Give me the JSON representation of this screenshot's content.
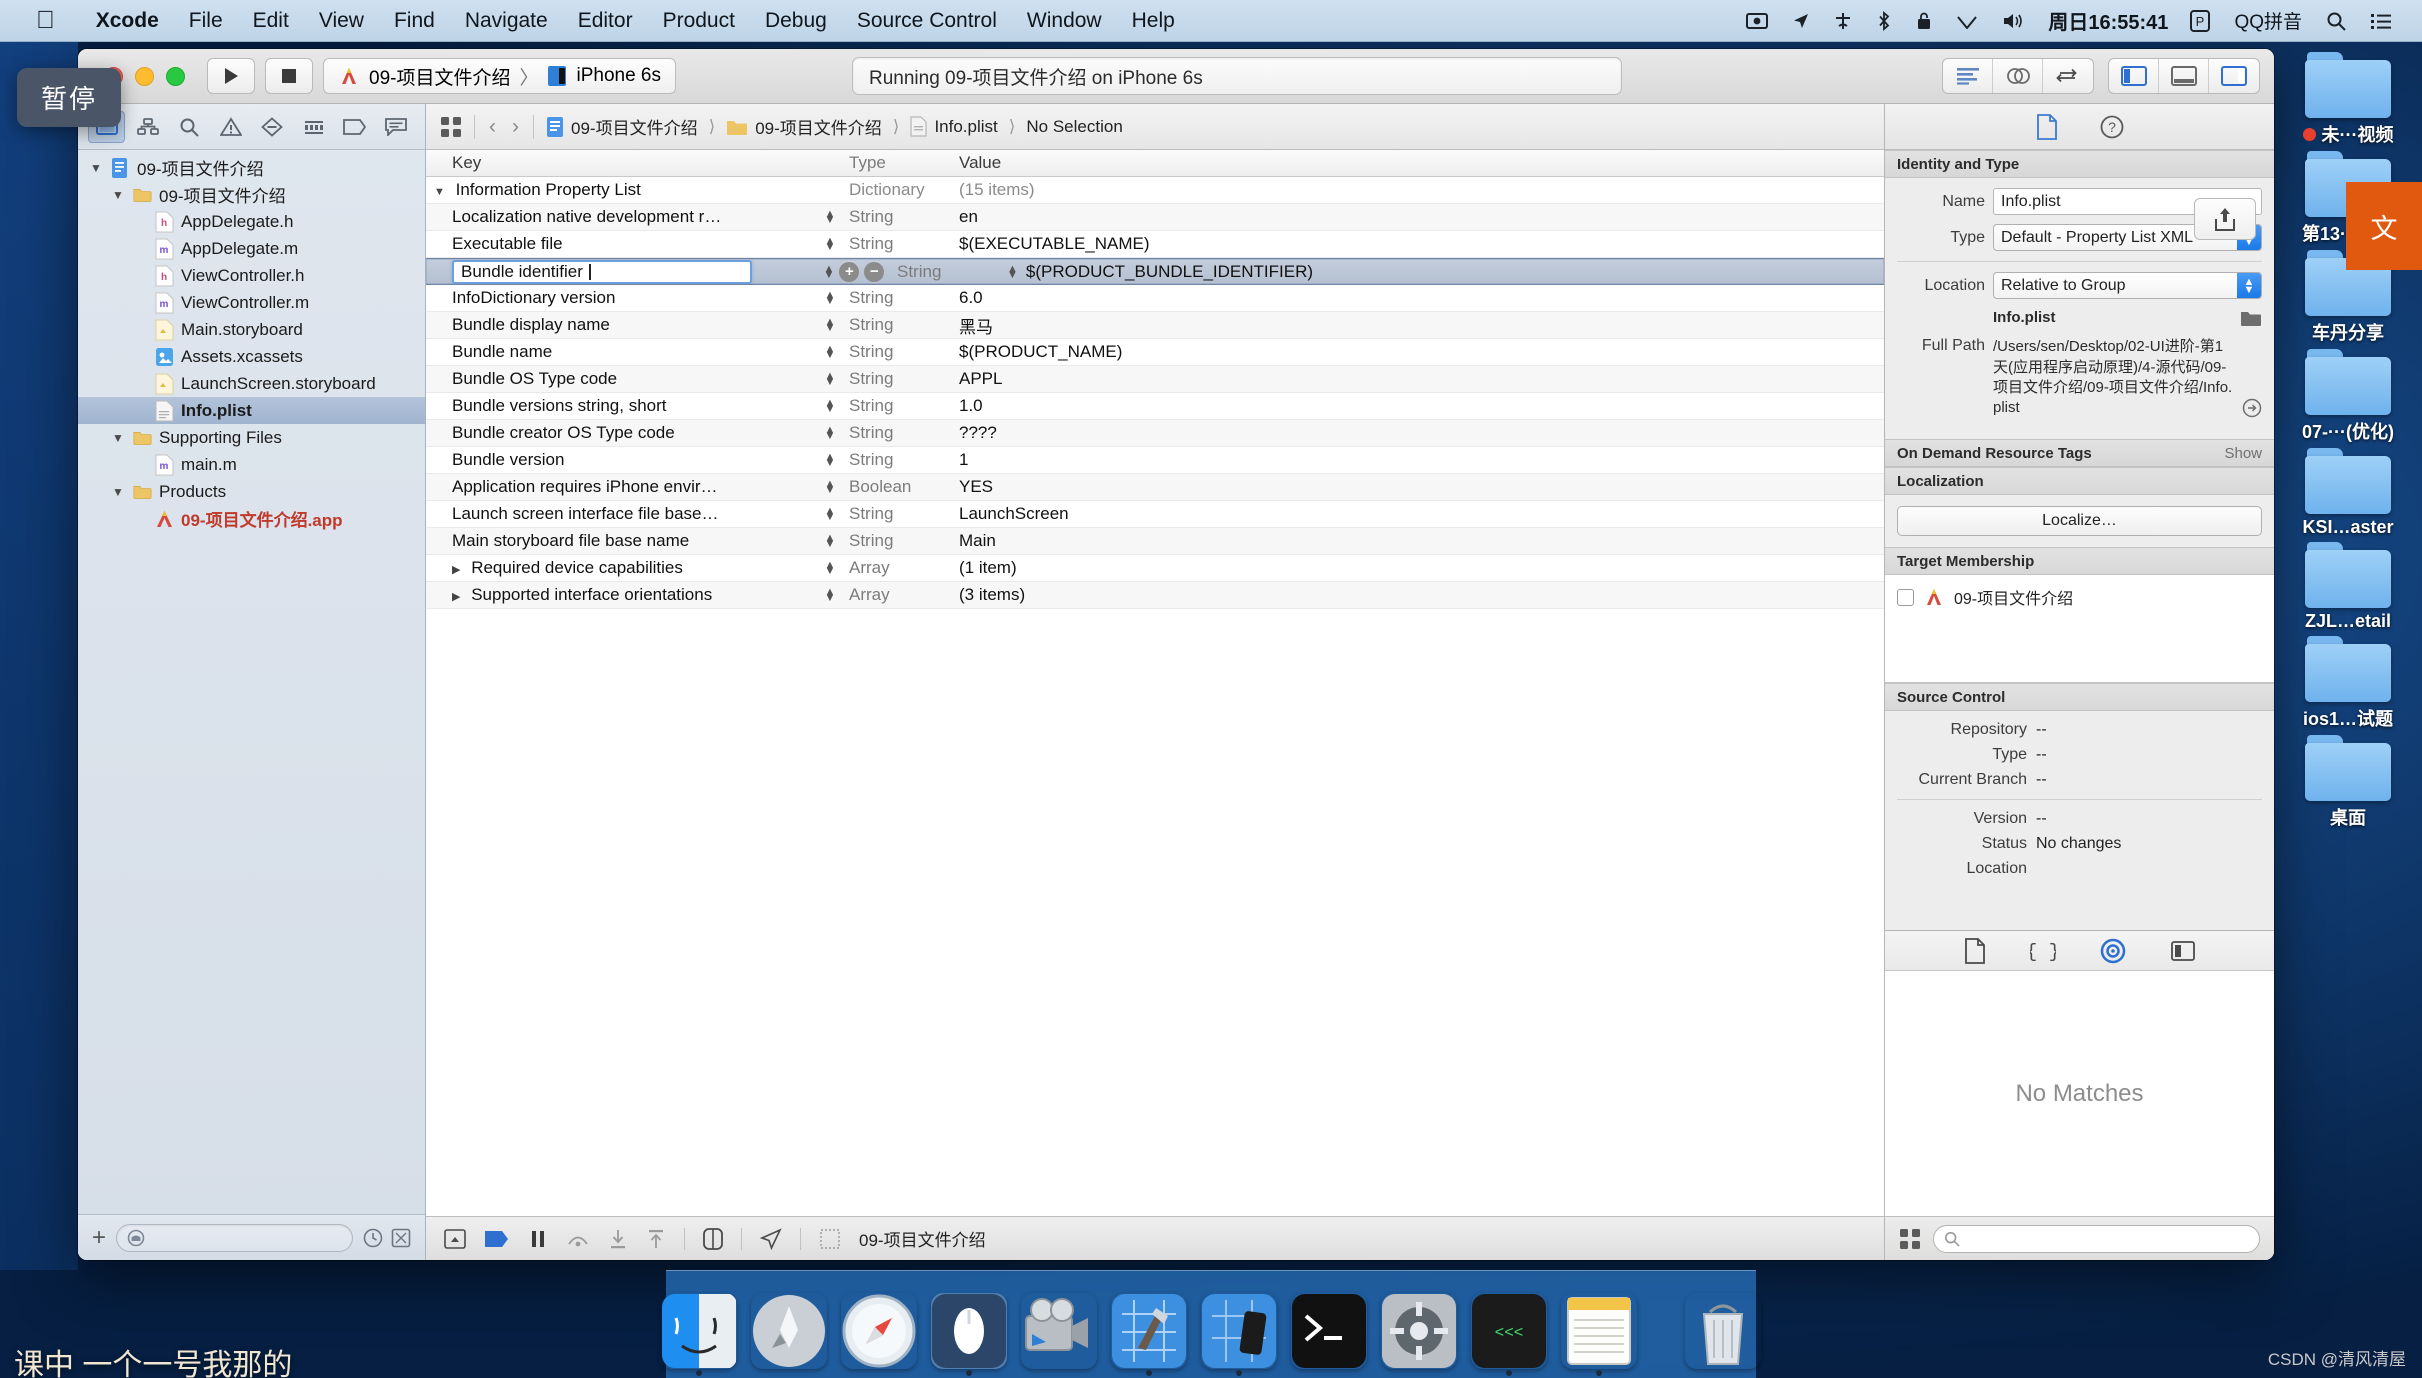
{
  "menubar": {
    "apple_icon": "apple-logo-icon",
    "items": [
      "Xcode",
      "File",
      "Edit",
      "View",
      "Find",
      "Navigate",
      "Editor",
      "Product",
      "Debug",
      "Source Control",
      "Window",
      "Help"
    ],
    "status_icons": [
      "screen-record-icon",
      "location-arrow-icon",
      "airdrop-icon",
      "bluetooth-icon",
      "lock-icon",
      "wifi-icon",
      "volume-icon"
    ],
    "clock": "周日16:55:41",
    "input_badge": "P",
    "input_method": "QQ拼音",
    "search_icon": "search-icon",
    "control_center_icon": "list-icon"
  },
  "tooltip": {
    "text": "暂停"
  },
  "toolbar": {
    "run_icon": "play-icon",
    "stop_icon": "stop-icon",
    "scheme_project": "09-项目文件介绍",
    "scheme_device": "iPhone 6s",
    "scheme_separator": "〉",
    "status": "Running 09-项目文件介绍 on iPhone 6s",
    "editor_modes": [
      "standard-editor-icon",
      "assistant-editor-icon",
      "version-editor-icon"
    ],
    "view_toggles": [
      "navigator-toggle-icon",
      "debug-area-toggle-icon",
      "utilities-toggle-icon"
    ]
  },
  "navigator": {
    "tabs": [
      "project-navigator-icon",
      "source-control-navigator-icon",
      "find-navigator-icon",
      "issue-navigator-icon",
      "test-navigator-icon",
      "debug-navigator-icon",
      "breakpoint-navigator-icon",
      "report-navigator-icon"
    ],
    "tree": [
      {
        "label": "09-项目文件介绍",
        "indent": 0,
        "twisty": "▼",
        "icon": "xcode-project-icon"
      },
      {
        "label": "09-项目文件介绍",
        "indent": 1,
        "twisty": "▼",
        "icon": "folder-icon"
      },
      {
        "label": "AppDelegate.h",
        "indent": 2,
        "twisty": "",
        "icon": "header-file-icon"
      },
      {
        "label": "AppDelegate.m",
        "indent": 2,
        "twisty": "",
        "icon": "objc-file-icon"
      },
      {
        "label": "ViewController.h",
        "indent": 2,
        "twisty": "",
        "icon": "header-file-icon"
      },
      {
        "label": "ViewController.m",
        "indent": 2,
        "twisty": "",
        "icon": "objc-file-icon"
      },
      {
        "label": "Main.storyboard",
        "indent": 2,
        "twisty": "",
        "icon": "storyboard-file-icon"
      },
      {
        "label": "Assets.xcassets",
        "indent": 2,
        "twisty": "",
        "icon": "assets-catalog-icon"
      },
      {
        "label": "LaunchScreen.storyboard",
        "indent": 2,
        "twisty": "",
        "icon": "storyboard-file-icon"
      },
      {
        "label": "Info.plist",
        "indent": 2,
        "twisty": "",
        "icon": "plist-file-icon",
        "selected": true
      },
      {
        "label": "Supporting Files",
        "indent": 1,
        "twisty": "▼",
        "icon": "folder-icon"
      },
      {
        "label": "main.m",
        "indent": 2,
        "twisty": "",
        "icon": "objc-file-icon"
      },
      {
        "label": "Products",
        "indent": 1,
        "twisty": "▼",
        "icon": "folder-icon"
      },
      {
        "label": "09-项目文件介绍.app",
        "indent": 2,
        "twisty": "",
        "icon": "app-product-icon",
        "red": true
      }
    ],
    "footer": {
      "add_icon": "plus-icon",
      "filter_placeholder": "",
      "filter_icon": "filter-icon",
      "recent_icon": "clock-icon",
      "unsaved_icon": "source-control-filter-icon"
    }
  },
  "jumpbar": {
    "grid_icon": "related-items-icon",
    "back_icon": "back-chevron-icon",
    "forward_icon": "forward-chevron-icon",
    "crumbs": [
      {
        "label": "09-项目文件介绍",
        "icon": "xcode-project-icon"
      },
      {
        "label": "09-项目文件介绍",
        "icon": "folder-icon"
      },
      {
        "label": "Info.plist",
        "icon": "plist-file-icon"
      },
      {
        "label": "No Selection",
        "icon": ""
      }
    ]
  },
  "plist": {
    "columns": [
      "Key",
      "Type",
      "Value"
    ],
    "rows": [
      {
        "key": "Information Property List",
        "type": "Dictionary",
        "value": "(15 items)",
        "twisty": "▼",
        "root": true
      },
      {
        "key": "Localization native development r…",
        "type": "String",
        "value": "en"
      },
      {
        "key": "Executable file",
        "type": "String",
        "value": "$(EXECUTABLE_NAME)"
      },
      {
        "key": "Bundle identifier",
        "type": "String",
        "value": "$(PRODUCT_BUNDLE_IDENTIFIER)",
        "selected": true,
        "editing": true
      },
      {
        "key": "InfoDictionary version",
        "type": "String",
        "value": "6.0"
      },
      {
        "key": "Bundle display name",
        "type": "String",
        "value": "黑马"
      },
      {
        "key": "Bundle name",
        "type": "String",
        "value": "$(PRODUCT_NAME)"
      },
      {
        "key": "Bundle OS Type code",
        "type": "String",
        "value": "APPL"
      },
      {
        "key": "Bundle versions string, short",
        "type": "String",
        "value": "1.0"
      },
      {
        "key": "Bundle creator OS Type code",
        "type": "String",
        "value": "????"
      },
      {
        "key": "Bundle version",
        "type": "String",
        "value": "1"
      },
      {
        "key": "Application requires iPhone envir…",
        "type": "Boolean",
        "value": "YES"
      },
      {
        "key": "Launch screen interface file base…",
        "type": "String",
        "value": "LaunchScreen"
      },
      {
        "key": "Main storyboard file base name",
        "type": "String",
        "value": "Main"
      },
      {
        "key": "Required device capabilities",
        "type": "Array",
        "value": "(1 item)",
        "twisty": "▶"
      },
      {
        "key": "Supported interface orientations",
        "type": "Array",
        "value": "(3 items)",
        "twisty": "▶"
      }
    ]
  },
  "debugbar": {
    "icons": [
      "hide-debug-area-icon",
      "breakpoints-icon",
      "pause-icon",
      "step-over-icon",
      "step-into-icon",
      "step-out-icon",
      "view-debugging-icon",
      "location-simulate-icon",
      "memory-graph-icon"
    ],
    "process": "09-项目文件介绍"
  },
  "inspector": {
    "tabs": [
      "file-inspector-icon",
      "quick-help-icon"
    ],
    "identity": {
      "section": "Identity and Type",
      "name_label": "Name",
      "name_value": "Info.plist",
      "type_label": "Type",
      "type_value": "Default - Property List XML",
      "location_label": "Location",
      "location_value": "Relative to Group",
      "file_name": "Info.plist",
      "folder_icon": "folder-picker-icon",
      "fullpath_label": "Full Path",
      "fullpath_value": "/Users/sen/Desktop/02-UI进阶-第1天(应用程序启动原理)/4-源代码/09-项目文件介绍/09-项目文件介绍/Info.plist",
      "reveal_icon": "arrow-circle-icon"
    },
    "on_demand": {
      "title": "On Demand Resource Tags",
      "show": "Show"
    },
    "localization": {
      "title": "Localization",
      "button": "Localize…"
    },
    "target_membership": {
      "title": "Target Membership",
      "item": "09-项目文件介绍"
    },
    "source_control": {
      "title": "Source Control",
      "rows": [
        {
          "label": "Repository",
          "value": "--"
        },
        {
          "label": "Type",
          "value": "--"
        },
        {
          "label": "Current Branch",
          "value": "--"
        },
        {
          "label": "Version",
          "value": "--"
        },
        {
          "label": "Status",
          "value": "No changes"
        },
        {
          "label": "Location",
          "value": ""
        }
      ]
    }
  },
  "library": {
    "tabs": [
      "file-template-library-icon",
      "code-snippet-library-icon",
      "media-library-icon",
      "object-library-icon"
    ],
    "active_tab_index": 2,
    "empty_text": "No Matches",
    "footer": {
      "grid_icon": "grid-icon",
      "search_placeholder": "",
      "search_icon": "search-icon"
    }
  },
  "desktop": {
    "folders": [
      {
        "label": "未···视频",
        "dot": true
      },
      {
        "label": "第13···业班"
      },
      {
        "label": "车丹分享"
      },
      {
        "label": "07-···(优化)"
      },
      {
        "label": "KSI…aster"
      },
      {
        "label": "ZJL…etail"
      },
      {
        "label": "ios1…试题"
      },
      {
        "label": "桌面"
      }
    ],
    "orange_note": "文",
    "share_icon": "share-icon"
  },
  "dock": {
    "items": [
      {
        "name": "finder-icon",
        "running": true
      },
      {
        "name": "launchpad-icon",
        "running": false
      },
      {
        "name": "safari-icon",
        "running": false
      },
      {
        "name": "mouse-app-icon",
        "running": true,
        "active": true
      },
      {
        "name": "quicktime-icon",
        "running": false
      },
      {
        "name": "xcode-icon",
        "running": true
      },
      {
        "name": "simulator-icon",
        "running": true
      },
      {
        "name": "terminal-icon",
        "running": false
      },
      {
        "name": "system-preferences-icon",
        "running": false
      },
      {
        "name": "console-icon",
        "running": true
      },
      {
        "name": "textedit-icon",
        "running": true
      },
      {
        "name": "trash-icon",
        "running": false
      }
    ]
  },
  "watermark": {
    "text": "CSDN @清风清屋"
  },
  "caption": {
    "text": "课中 一个一号我那的"
  },
  "colors": {
    "accent": "#1a7ae8",
    "selection": "#b4c0d1",
    "desktop": "#0c3d7e",
    "orange": "#e1580f",
    "red_label": "#c0392b"
  }
}
